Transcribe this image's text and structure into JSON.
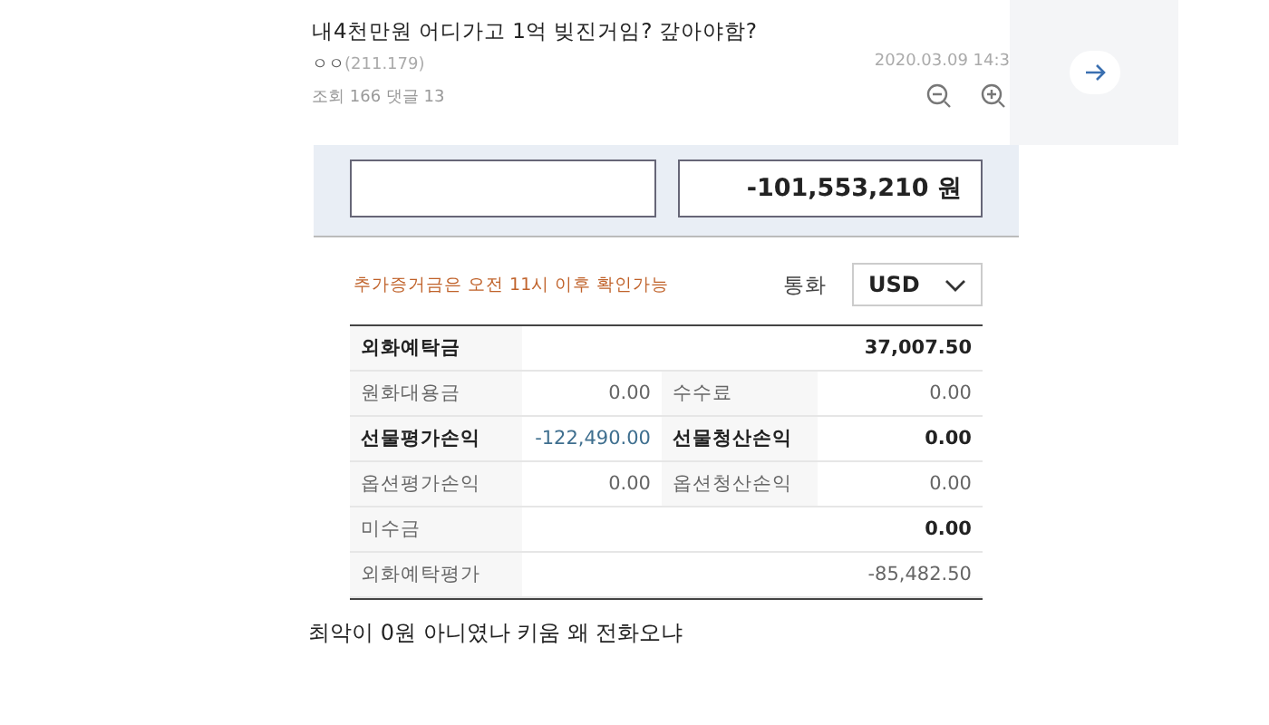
{
  "post": {
    "title": "내4천만원 어디가고 1억 빚진거임? 갚아야함?",
    "author": "ㅇㅇ",
    "ip": "(211.179)",
    "date": "2020.03.09 14:3",
    "stats": "조회 166 댓글 13"
  },
  "screenshot": {
    "amount": "-101,553,210 원",
    "notice": "추가증거금은 오전 11시 이후 확인가능",
    "currency_label": "통화",
    "currency": "USD",
    "rows": [
      {
        "kind": "full",
        "cells": [
          {
            "text": "외화예탁금",
            "bold": true
          },
          {
            "text": "37,007.50",
            "bold": true,
            "accent": false
          }
        ]
      },
      {
        "kind": "split",
        "cells": [
          {
            "text": "원화대용금",
            "bold": false
          },
          {
            "text": "0.00",
            "bold": false,
            "accent": false
          },
          {
            "text": "수수료",
            "bold": false
          },
          {
            "text": "0.00",
            "bold": false,
            "accent": false
          }
        ]
      },
      {
        "kind": "split",
        "cells": [
          {
            "text": "선물평가손익",
            "bold": true
          },
          {
            "text": "-122,490.00",
            "bold": false,
            "accent": true
          },
          {
            "text": "선물청산손익",
            "bold": true
          },
          {
            "text": "0.00",
            "bold": true,
            "accent": false
          }
        ]
      },
      {
        "kind": "split",
        "cells": [
          {
            "text": "옵션평가손익",
            "bold": false
          },
          {
            "text": "0.00",
            "bold": false,
            "accent": false
          },
          {
            "text": "옵션청산손익",
            "bold": false
          },
          {
            "text": "0.00",
            "bold": false,
            "accent": false
          }
        ]
      },
      {
        "kind": "full",
        "cells": [
          {
            "text": "미수금",
            "bold": false
          },
          {
            "text": "0.00",
            "bold": true,
            "accent": false
          }
        ]
      },
      {
        "kind": "full",
        "cells": [
          {
            "text": "외화예탁평가",
            "bold": false
          },
          {
            "text": "-85,482.50",
            "bold": false,
            "accent": false
          }
        ]
      }
    ]
  },
  "comment": "최악이 0원 아니였나 키움 왜 전화오냐"
}
